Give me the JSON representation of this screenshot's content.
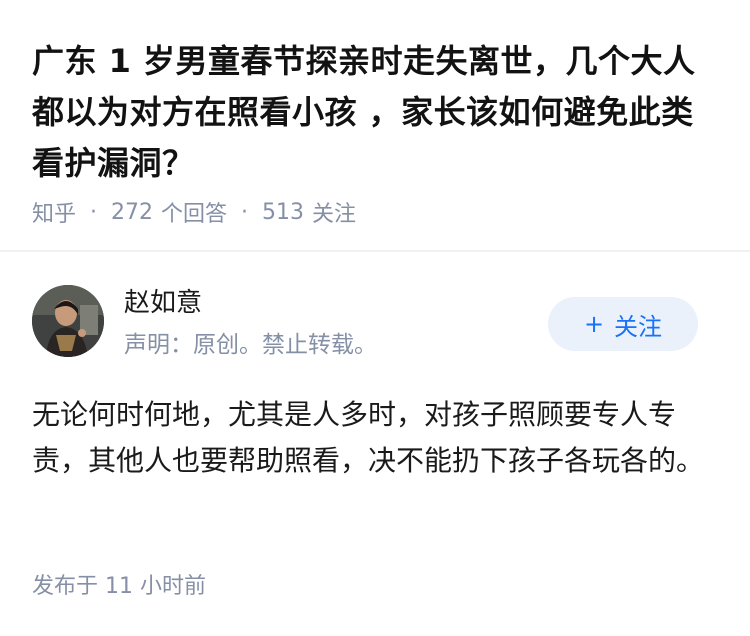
{
  "question": {
    "title": "广东 1 岁男童春节探亲时走失离世，几个大人都以为对方在照看小孩 ，家长该如何避免此类看护漏洞？",
    "source": "知乎",
    "answers_count": "272",
    "answers_label": "个回答",
    "followers_count": "513",
    "followers_label": "关注"
  },
  "author": {
    "name": "赵如意",
    "signature": "声明：原创。禁止转载。",
    "follow_label": "关注"
  },
  "answer": {
    "content": "无论何时何地，尤其是人多时，对孩子照顾要专人专责，其他人也要帮助照看，决不能扔下孩子各玩各的。",
    "published": "发布于 11 小时前"
  },
  "colors": {
    "meta_gray": "#8590a6",
    "follow_blue": "#1772f6",
    "follow_bg": "#eaf1fb"
  }
}
